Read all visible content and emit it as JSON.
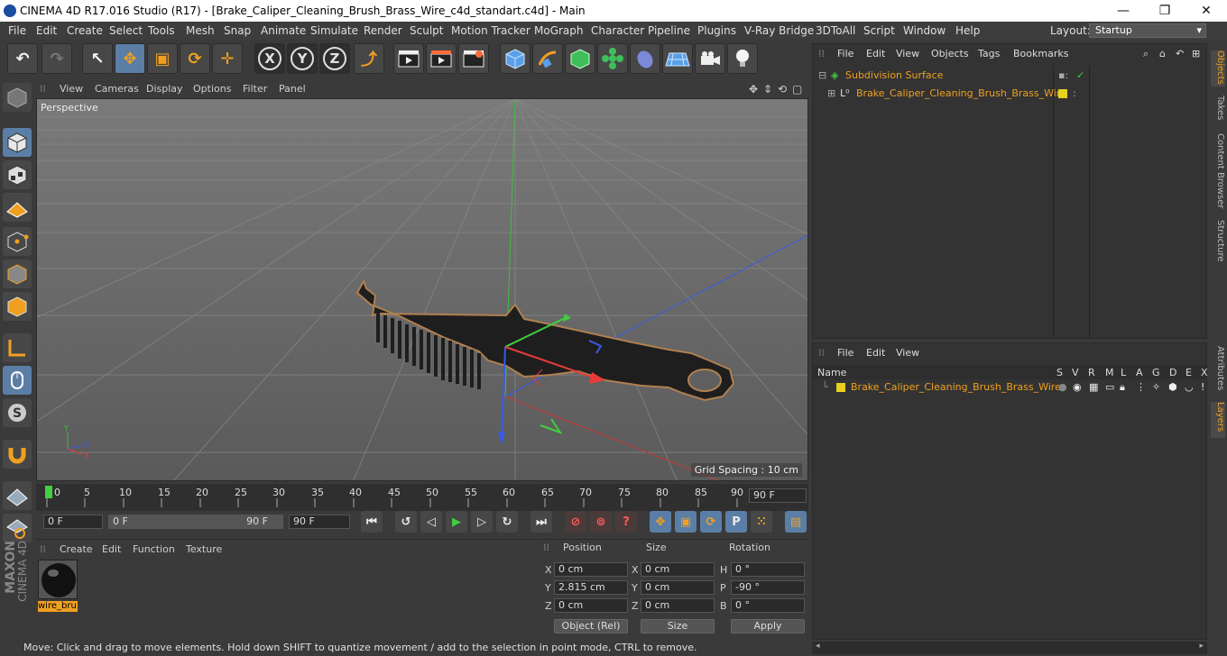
{
  "window": {
    "title": "CINEMA 4D R17.016 Studio (R17) - [Brake_Caliper_Cleaning_Brush_Brass_Wire_c4d_standart.c4d] - Main",
    "minimize": "—",
    "maximize": "❐",
    "close": "✕"
  },
  "menu": [
    "File",
    "Edit",
    "Create",
    "Select",
    "Tools",
    "Mesh",
    "Snap",
    "Animate",
    "Simulate",
    "Render",
    "Sculpt",
    "Motion Tracker",
    "MoGraph",
    "Character",
    "Pipeline",
    "Plugins",
    "V-Ray Bridge",
    "3DToAll",
    "Script",
    "Window",
    "Help"
  ],
  "layout": {
    "label": "Layout:",
    "value": "Startup"
  },
  "toolbar": {
    "undo": "↶",
    "redo": "↷",
    "select": "↖",
    "move": "✥",
    "scale": "▣",
    "rotate": "⟳",
    "add": "✛",
    "x": "X",
    "y": "Y",
    "z": "Z",
    "coords": "⤴"
  },
  "viewport": {
    "menu": [
      "View",
      "Cameras",
      "Display",
      "Options",
      "Filter",
      "Panel"
    ],
    "camera": "Perspective",
    "grid_spacing": "Grid Spacing : 10 cm"
  },
  "timeline": {
    "ticks": [
      "0",
      "5",
      "10",
      "15",
      "20",
      "25",
      "30",
      "35",
      "40",
      "45",
      "50",
      "55",
      "60",
      "65",
      "70",
      "75",
      "80",
      "85",
      "90"
    ],
    "end_frame": "90 F"
  },
  "transport": {
    "start": "0 F",
    "range_start": "0 F",
    "range_end": "90 F",
    "end": "90 F"
  },
  "materials": {
    "menu": [
      "Create",
      "Edit",
      "Function",
      "Texture"
    ],
    "items": [
      {
        "name": "wire_bru"
      }
    ]
  },
  "coords": {
    "headers": {
      "position": "Position",
      "size": "Size",
      "rotation": "Rotation"
    },
    "rows": [
      {
        "axis": "X",
        "pos": "0 cm",
        "saxis": "X",
        "size": "0 cm",
        "raxis": "H",
        "rot": "0 °"
      },
      {
        "axis": "Y",
        "pos": "2.815 cm",
        "saxis": "Y",
        "size": "0 cm",
        "raxis": "P",
        "rot": "-90 °"
      },
      {
        "axis": "Z",
        "pos": "0 cm",
        "saxis": "Z",
        "size": "0 cm",
        "raxis": "B",
        "rot": "0 °"
      }
    ],
    "mode": "Object (Rel)",
    "size_mode": "Size",
    "apply": "Apply"
  },
  "brand": {
    "maxon": "MAXON",
    "c4d": "CINEMA 4D"
  },
  "status": "Move: Click and drag to move elements. Hold down SHIFT to quantize movement / add to the selection in point mode, CTRL to remove.",
  "objects": {
    "menu": [
      "File",
      "Edit",
      "View",
      "Objects",
      "Tags",
      "Bookmarks"
    ],
    "tree": [
      {
        "name": "Subdivision Surface",
        "color": "#f0a020"
      },
      {
        "name": "Brake_Caliper_Cleaning_Brush_Brass_Wire",
        "color": "#f0a020"
      }
    ]
  },
  "layers": {
    "menu": [
      "File",
      "Edit",
      "View"
    ],
    "header": {
      "name": "Name",
      "cols": [
        "S",
        "V",
        "R",
        "M",
        "L",
        "A",
        "G",
        "D",
        "E",
        "X"
      ]
    },
    "rows": [
      {
        "name": "Brake_Caliper_Cleaning_Brush_Brass_Wire",
        "color": "#e8d020"
      }
    ]
  },
  "side_tabs": [
    "Objects",
    "Takes",
    "Content Browser",
    "Structure",
    "Attributes",
    "Layers"
  ]
}
